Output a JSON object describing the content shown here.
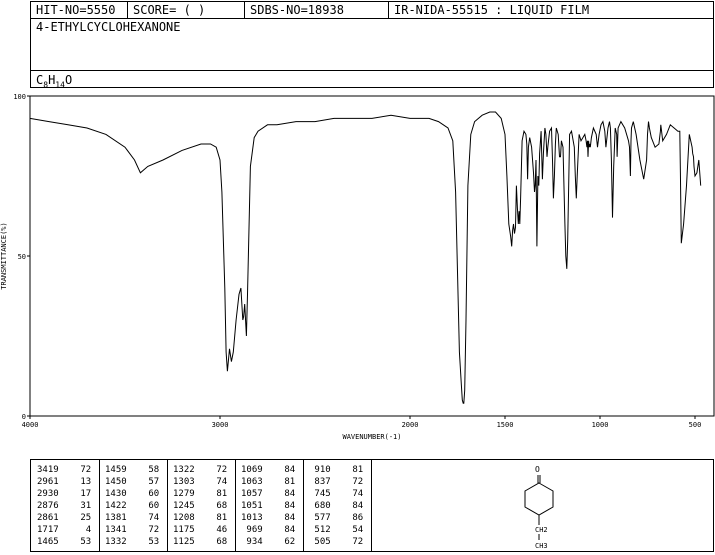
{
  "header": {
    "hit_no": "HIT-NO=5550",
    "score": "SCORE=  (    )",
    "sdbs_no": "SDBS-NO=18938",
    "ir_info": "IR-NIDA-55515 : LIQUID FILM"
  },
  "compound": {
    "name": "4-ETHYLCYCLOHEXANONE",
    "formula_parts": [
      "C",
      "8",
      "H",
      "14",
      "O"
    ]
  },
  "chart_data": {
    "type": "line",
    "xlabel": "WAVENUMBER(-1)",
    "ylabel": "TRANSMITTANCE(%)",
    "xlim": [
      4000,
      400
    ],
    "ylim": [
      0,
      100
    ],
    "xticks": [
      4000,
      3000,
      2000,
      1500,
      1000,
      500
    ],
    "yticks": [
      0,
      50,
      100
    ],
    "x": [
      4000,
      3900,
      3800,
      3700,
      3600,
      3500,
      3450,
      3419,
      3380,
      3300,
      3200,
      3100,
      3050,
      3020,
      3000,
      2990,
      2975,
      2968,
      2961,
      2955,
      2950,
      2940,
      2930,
      2915,
      2900,
      2890,
      2880,
      2876,
      2870,
      2861,
      2855,
      2840,
      2820,
      2800,
      2750,
      2700,
      2600,
      2500,
      2400,
      2300,
      2200,
      2100,
      2000,
      1900,
      1850,
      1800,
      1775,
      1760,
      1750,
      1740,
      1730,
      1725,
      1720,
      1717,
      1712,
      1705,
      1695,
      1680,
      1660,
      1620,
      1580,
      1550,
      1520,
      1500,
      1490,
      1480,
      1470,
      1465,
      1460,
      1455,
      1450,
      1445,
      1440,
      1435,
      1430,
      1426,
      1422,
      1418,
      1410,
      1400,
      1390,
      1385,
      1381,
      1377,
      1370,
      1360,
      1350,
      1345,
      1341,
      1337,
      1332,
      1327,
      1322,
      1318,
      1310,
      1303,
      1298,
      1290,
      1285,
      1279,
      1275,
      1265,
      1255,
      1250,
      1245,
      1240,
      1235,
      1230,
      1220,
      1213,
      1208,
      1203,
      1195,
      1185,
      1180,
      1175,
      1170,
      1160,
      1150,
      1135,
      1130,
      1125,
      1120,
      1110,
      1100,
      1090,
      1080,
      1073,
      1069,
      1066,
      1063,
      1060,
      1057,
      1054,
      1051,
      1045,
      1035,
      1020,
      1013,
      1005,
      995,
      985,
      975,
      969,
      965,
      958,
      950,
      945,
      940,
      934,
      928,
      920,
      912,
      910,
      905,
      890,
      870,
      850,
      845,
      840,
      837,
      834,
      825,
      810,
      790,
      770,
      755,
      750,
      745,
      740,
      730,
      710,
      690,
      682,
      680,
      678,
      670,
      650,
      630,
      610,
      590,
      580,
      577,
      572,
      560,
      545,
      530,
      515,
      512,
      508,
      505,
      500,
      490,
      480,
      470,
      460,
      450,
      430,
      415,
      400
    ],
    "y": [
      93,
      92,
      91,
      90,
      88,
      84,
      80,
      76,
      78,
      80,
      83,
      85,
      85,
      84,
      80,
      70,
      40,
      20,
      14,
      18,
      21,
      17,
      20,
      30,
      38,
      40,
      30,
      31,
      35,
      25,
      38,
      78,
      87,
      89,
      91,
      91,
      92,
      92,
      93,
      93,
      93,
      94,
      93,
      93,
      92,
      90,
      86,
      70,
      45,
      20,
      10,
      5,
      4,
      4,
      8,
      30,
      72,
      88,
      92,
      94,
      95,
      95,
      93,
      88,
      75,
      60,
      56,
      53,
      58,
      60,
      57,
      59,
      72,
      65,
      60,
      64,
      60,
      68,
      86,
      89,
      88,
      85,
      74,
      84,
      87,
      84,
      76,
      70,
      72,
      80,
      53,
      75,
      72,
      82,
      89,
      74,
      82,
      90,
      88,
      81,
      84,
      89,
      90,
      80,
      68,
      75,
      85,
      90,
      88,
      81,
      81,
      86,
      84,
      60,
      50,
      46,
      55,
      88,
      89,
      84,
      75,
      68,
      75,
      88,
      86,
      87,
      88,
      86,
      84,
      86,
      81,
      86,
      84,
      85,
      84,
      87,
      90,
      88,
      84,
      88,
      91,
      92,
      89,
      84,
      86,
      90,
      92,
      90,
      80,
      62,
      78,
      90,
      88,
      81,
      90,
      92,
      90,
      86,
      84,
      75,
      86,
      90,
      92,
      88,
      80,
      74,
      80,
      88,
      92,
      90,
      87,
      84,
      85,
      89,
      91,
      90,
      86,
      88,
      91,
      90,
      89,
      89,
      76,
      54,
      60,
      72,
      88,
      84,
      82,
      81,
      78,
      75,
      76,
      80,
      72
    ]
  },
  "peak_table": [
    [
      [
        "3419",
        "72"
      ],
      [
        "2961",
        "13"
      ],
      [
        "2930",
        "17"
      ],
      [
        "2876",
        "31"
      ],
      [
        "2861",
        "25"
      ],
      [
        "1717",
        "4"
      ],
      [
        "1465",
        "53"
      ]
    ],
    [
      [
        "1459",
        "58"
      ],
      [
        "1450",
        "57"
      ],
      [
        "1430",
        "60"
      ],
      [
        "1422",
        "60"
      ],
      [
        "1381",
        "74"
      ],
      [
        "1341",
        "72"
      ],
      [
        "1332",
        "53"
      ]
    ],
    [
      [
        "1322",
        "72"
      ],
      [
        "1303",
        "74"
      ],
      [
        "1279",
        "81"
      ],
      [
        "1245",
        "68"
      ],
      [
        "1208",
        "81"
      ],
      [
        "1175",
        "46"
      ],
      [
        "1125",
        "68"
      ]
    ],
    [
      [
        "1069",
        "84"
      ],
      [
        "1063",
        "81"
      ],
      [
        "1057",
        "84"
      ],
      [
        "1051",
        "84"
      ],
      [
        "1013",
        "84"
      ],
      [
        "969",
        "84"
      ],
      [
        "934",
        "62"
      ]
    ],
    [
      [
        "910",
        "81"
      ],
      [
        "837",
        "72"
      ],
      [
        "745",
        "74"
      ],
      [
        "680",
        "84"
      ],
      [
        "577",
        "86"
      ],
      [
        "512",
        "54"
      ],
      [
        "505",
        "72"
      ]
    ]
  ],
  "structure": {
    "label_top": "O",
    "label_ch2": "CH2",
    "label_ch3": "CH3"
  }
}
